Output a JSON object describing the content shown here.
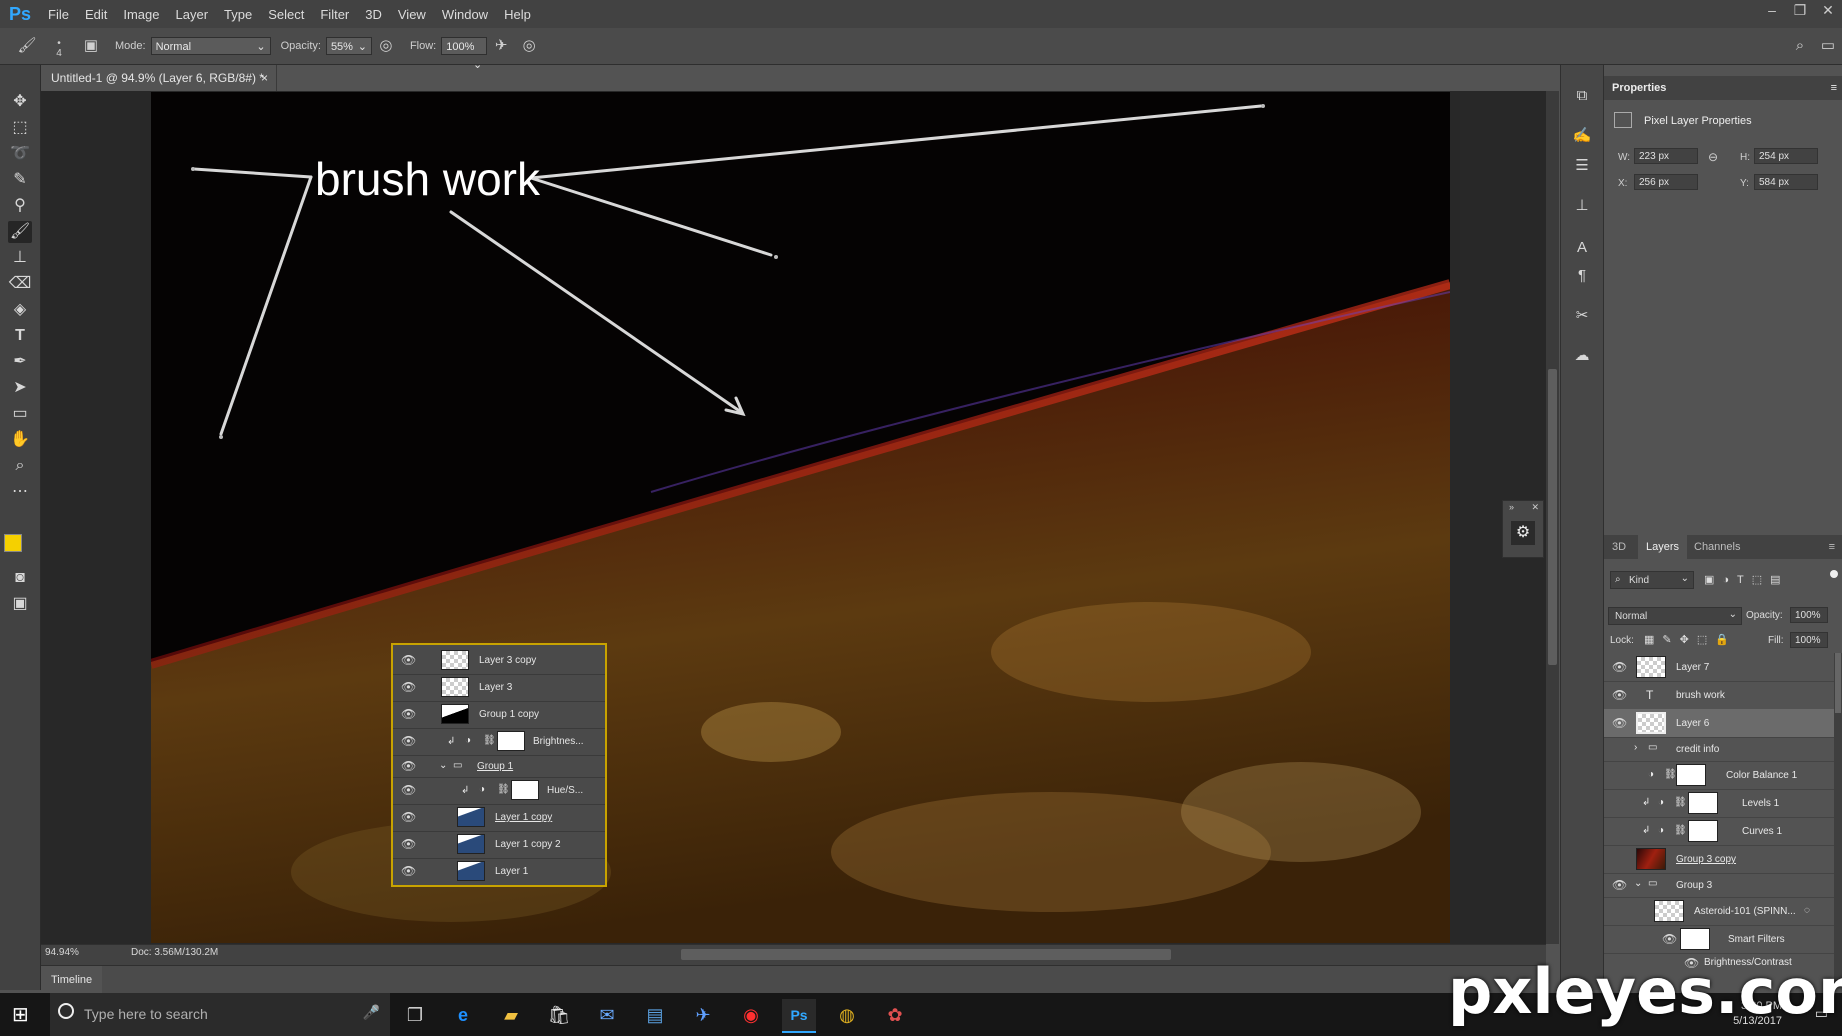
{
  "app": {
    "logo": "Ps"
  },
  "menu": [
    "File",
    "Edit",
    "Image",
    "Layer",
    "Type",
    "Select",
    "Filter",
    "3D",
    "View",
    "Window",
    "Help"
  ],
  "options": {
    "brush_size": "4",
    "mode_label": "Mode:",
    "mode_value": "Normal",
    "opacity_label": "Opacity:",
    "opacity_value": "55%",
    "flow_label": "Flow:",
    "flow_value": "100%"
  },
  "document": {
    "tab_title": "Untitled-1 @ 94.9% (Layer 6, RGB/8#) *",
    "canvas_text": "brush work",
    "zoom": "94.94%",
    "doc_info": "Doc: 3.56M/130.2M"
  },
  "inset_layers": [
    {
      "name": "Layer 3 copy"
    },
    {
      "name": "Layer 3"
    },
    {
      "name": "Group 1 copy"
    },
    {
      "name": "Brightnes..."
    },
    {
      "name": "Group 1"
    },
    {
      "name": "Hue/S..."
    },
    {
      "name": "Layer 1 copy"
    },
    {
      "name": "Layer 1 copy 2"
    },
    {
      "name": "Layer 1"
    }
  ],
  "timeline": {
    "label": "Timeline"
  },
  "properties": {
    "tab": "Properties",
    "heading": "Pixel Layer Properties",
    "w_label": "W:",
    "w_value": "223 px",
    "h_label": "H:",
    "h_value": "254 px",
    "x_label": "X:",
    "x_value": "256 px",
    "y_label": "Y:",
    "y_value": "584 px"
  },
  "layers_panel": {
    "tabs": [
      "3D",
      "Layers",
      "Channels"
    ],
    "kind_label": "Kind",
    "blend_mode": "Normal",
    "opacity_label": "Opacity:",
    "opacity_value": "100%",
    "lock_label": "Lock:",
    "fill_label": "Fill:",
    "fill_value": "100%",
    "layers": [
      {
        "name": "Layer 7"
      },
      {
        "name": "brush work"
      },
      {
        "name": "Layer 6"
      },
      {
        "name": "credit info"
      },
      {
        "name": "Color Balance 1"
      },
      {
        "name": "Levels 1"
      },
      {
        "name": "Curves 1"
      },
      {
        "name": "Group 3 copy"
      },
      {
        "name": "Group 3"
      },
      {
        "name": "Asteroid-101 (SPINN..."
      },
      {
        "name": "Smart Filters"
      },
      {
        "name": "Brightness/Contrast"
      }
    ]
  },
  "taskbar": {
    "search_placeholder": "Type here to search",
    "time": "3:20 PM",
    "date": "5/13/2017"
  },
  "watermark": "pxleyes.com",
  "colors": {
    "foreground": "#f5d000",
    "background": "#000000",
    "accent": "#31a8ff",
    "inset_border": "#c8a300"
  }
}
